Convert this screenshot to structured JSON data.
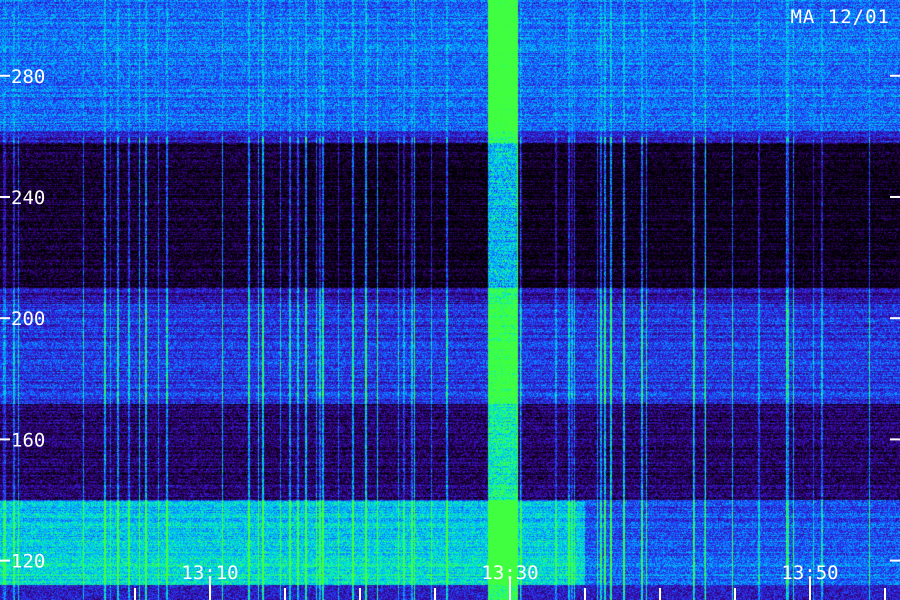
{
  "station_label": "MA 12/01",
  "chart_data": {
    "type": "heatmap",
    "title": "",
    "xlabel": "",
    "ylabel": "",
    "x_tick_labels": [
      "13:10",
      "13:30",
      "13:50"
    ],
    "x_ticks_minutes": [
      790,
      810,
      830
    ],
    "x_minor_tick_minutes": [
      785,
      790,
      795,
      800,
      805,
      810,
      815,
      820,
      825,
      830,
      835,
      840
    ],
    "xlim_minutes": [
      776,
      836
    ],
    "y_ticks": [
      120,
      160,
      200,
      240,
      280
    ],
    "y_tick_labels": [
      "120",
      "160",
      "200",
      "240",
      "280"
    ],
    "ylim": [
      107,
      305
    ],
    "colormap": [
      "#000000",
      "#2a0055",
      "#3a10c0",
      "#1a4dff",
      "#00b0ff",
      "#00f0c8",
      "#40ff40"
    ],
    "features": [
      {
        "description": "strong broadband burst",
        "time_minutes": [
          808.5,
          810.5
        ],
        "intensity": 0.95
      },
      {
        "description": "bright low-frequency emission band",
        "freq_range": [
          115,
          140
        ],
        "time_minutes": [
          776,
          815
        ],
        "intensity": 0.75
      },
      {
        "description": "bright band near top",
        "freq_range": [
          262,
          290
        ],
        "intensity": 0.6
      },
      {
        "description": "quiet band",
        "freq_range": [
          210,
          258
        ],
        "intensity": 0.1
      },
      {
        "description": "active mid band",
        "freq_range": [
          172,
          205
        ],
        "intensity": 0.45
      }
    ]
  }
}
